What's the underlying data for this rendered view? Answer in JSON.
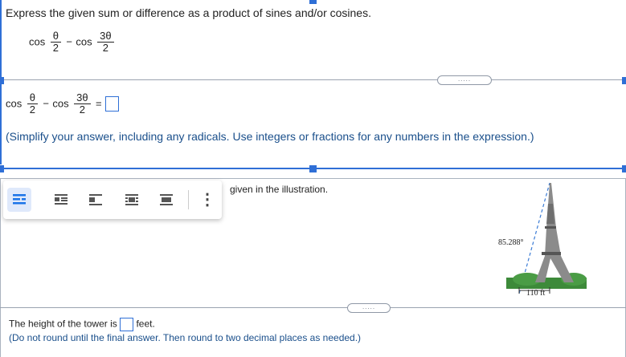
{
  "question": {
    "instruction": "Express the given sum or difference as a product of sines and/or cosines.",
    "expr": {
      "fn1": "cos",
      "num1": "θ",
      "den1": "2",
      "minus": "−",
      "fn2": "cos",
      "num2": "3θ",
      "den2": "2"
    }
  },
  "answer": {
    "expr": {
      "fn1": "cos",
      "num1": "θ",
      "den1": "2",
      "minus": "−",
      "fn2": "cos",
      "num2": "3θ",
      "den2": "2",
      "equals": "="
    },
    "note": "(Simplify your answer, including any radicals. Use integers or fractions for any numbers in the expression.)"
  },
  "divider": {
    "dots": "....."
  },
  "problem2": {
    "intro": "given in the illustration.",
    "figure": {
      "angle": "85.288°",
      "distance": "110 ft"
    },
    "answer_prefix": "The height of the tower is",
    "answer_suffix": "feet.",
    "note": "(Do not round until the final answer. Then round to two decimal places as needed.)"
  },
  "toolbar": {
    "icons": [
      "align-left-icon",
      "align-center-small-icon",
      "align-left-alt-icon",
      "align-justify-icon",
      "align-block-icon",
      "more-vert-icon"
    ],
    "more_label": "⋮"
  }
}
